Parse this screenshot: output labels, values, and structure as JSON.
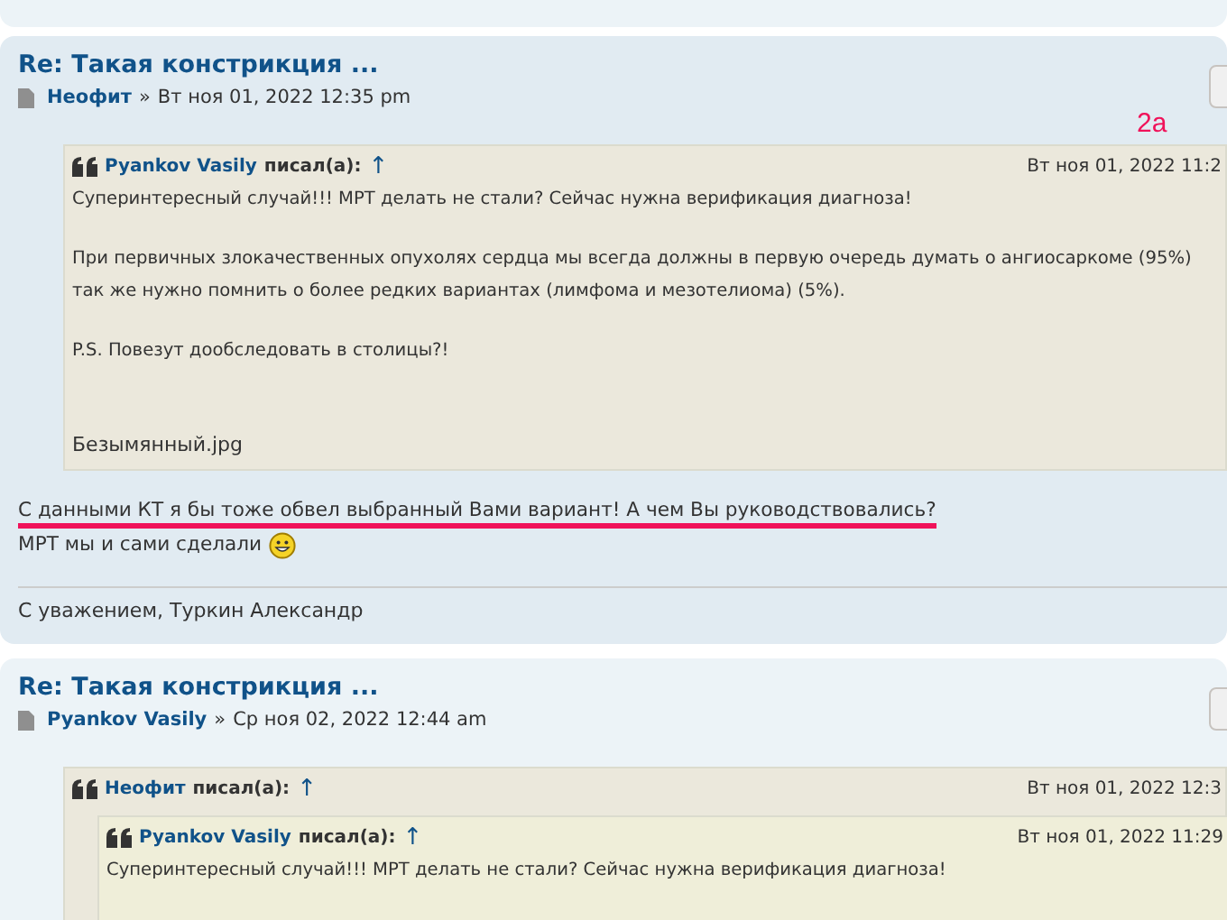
{
  "posts": [
    {
      "title": "Re: Такая констрикция ...",
      "author": "Неофит",
      "separator": "»",
      "date": "Вт ноя 01, 2022 12:35 pm",
      "annotation": "2a",
      "quote": {
        "author": "Pyankov Vasily",
        "wrote": "писал(а):",
        "up": "↑",
        "date": "Вт ноя 01, 2022 11:2",
        "paragraphs": [
          "Суперинтересный случай!!! МРТ делать не стали? Сейчас нужна верификация диагноза!",
          "При первичных злокачественных опухолях сердца мы всегда должны в первую очередь думать о ангиосаркоме (95%)\nтак же нужно помнить о более редких вариантах (лимфома и мезотелиома) (5%).",
          "P.S. Повезут дообследовать в столицы?!"
        ],
        "attachment": "Безымянный.jpg"
      },
      "body": [
        {
          "text": "С данными КТ я бы тоже обвел выбранный Вами вариант! А чем Вы руководствовались?",
          "underlined": true,
          "smiley": false
        },
        {
          "text": "МРТ мы и сами сделали",
          "underlined": false,
          "smiley": true
        }
      ],
      "signature": "С уважением, Туркин Александр"
    },
    {
      "title": "Re: Такая констрикция ...",
      "author": "Pyankov Vasily",
      "separator": "»",
      "date": "Ср ноя 02, 2022 12:44 am",
      "quote": {
        "author": "Неофит",
        "wrote": "писал(а):",
        "up": "↑",
        "date": "Вт ноя 01, 2022 12:3",
        "quotes": [
          {
            "author": "Pyankov Vasily",
            "wrote": "писал(а):",
            "up": "↑",
            "date": "Вт ноя 01, 2022 11:29",
            "paragraphs": [
              "Суперинтересный случай!!! МРТ делать не стали? Сейчас нужна верификация диагноза!"
            ]
          }
        ]
      }
    }
  ]
}
